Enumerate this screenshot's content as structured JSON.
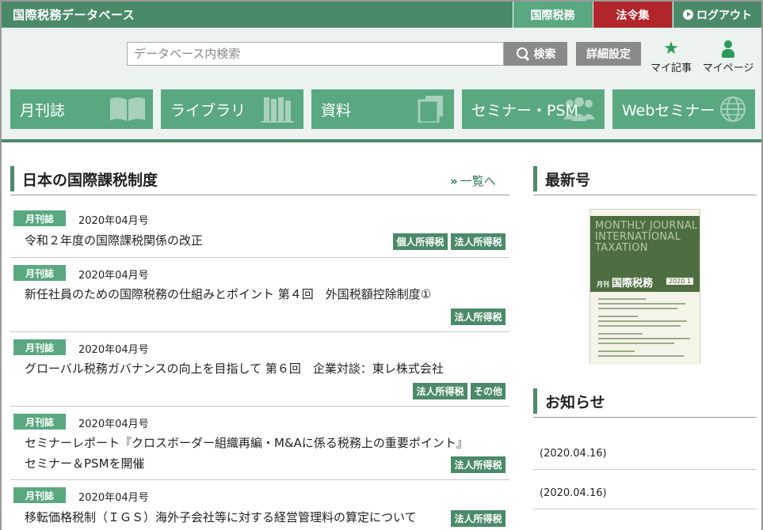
{
  "topbar": {
    "site_title": "国際税務データベース",
    "tab_tax": "国際税務",
    "tab_law": "法令集",
    "logout": "ログアウト"
  },
  "header": {
    "search_placeholder": "データベース内検索",
    "search_button": "検索",
    "advanced_button": "詳細設定",
    "my_articles": "マイ記事",
    "my_page": "マイページ"
  },
  "nav": [
    {
      "label": "月刊誌",
      "icon": "book-icon"
    },
    {
      "label": "ライブラリ",
      "icon": "bookshelf-icon"
    },
    {
      "label": "資料",
      "icon": "documents-icon"
    },
    {
      "label": "セミナー・PSM",
      "icon": "group-icon"
    },
    {
      "label": "Webセミナー",
      "icon": "globe-icon"
    }
  ],
  "main": {
    "section_title": "日本の国際課税制度",
    "more_link": "一覧へ",
    "articles": [
      {
        "category": "月刊誌",
        "date": "2020年04月号",
        "title_lines": [
          "令和２年度の国際課税関係の改正"
        ],
        "tags": [
          "個人所得税",
          "法人所得税"
        ]
      },
      {
        "category": "月刊誌",
        "date": "2020年04月号",
        "title_lines": [
          "新任社員のための国際税務の仕組みとポイント 第４回　外国税額控除制度①"
        ],
        "tags": [
          "法人所得税"
        ]
      },
      {
        "category": "月刊誌",
        "date": "2020年04月号",
        "title_lines": [
          "グローバル税務ガバナンスの向上を目指して 第６回　企業対談：東レ株式会社"
        ],
        "tags": [
          "法人所得税",
          "その他"
        ]
      },
      {
        "category": "月刊誌",
        "date": "2020年04月号",
        "title_lines": [
          "セミナーレポート『クロスボーダー組織再編・M&Aに係る税務上の重要ポイント』",
          "セミナー＆PSMを開催"
        ],
        "tags": [
          "法人所得税"
        ]
      },
      {
        "category": "月刊誌",
        "date": "2020年04月号",
        "title_lines": [
          "移転価格税制（ＩＧＳ）海外子会社等に対する経営管理料の算定について"
        ],
        "tags": [
          "法人所得税"
        ]
      }
    ]
  },
  "sidebar": {
    "latest_title": "最新号",
    "cover": {
      "title_en": "MONTHLY JOURNAL INTERNATIONAL TAXATION",
      "title_jp": "国際税務",
      "title_jp_prefix": "月刊",
      "issue": "2020 1",
      "bg_color": "#4e6e41"
    },
    "news_title": "お知らせ",
    "news": [
      {
        "date": "(2020.04.16)"
      },
      {
        "date": "(2020.04.16)"
      }
    ]
  },
  "colors": {
    "brand_dark": "#4b8a69",
    "brand_light": "#5aa880",
    "law_red": "#b2252a",
    "header_bg": "#ecf3ef"
  }
}
